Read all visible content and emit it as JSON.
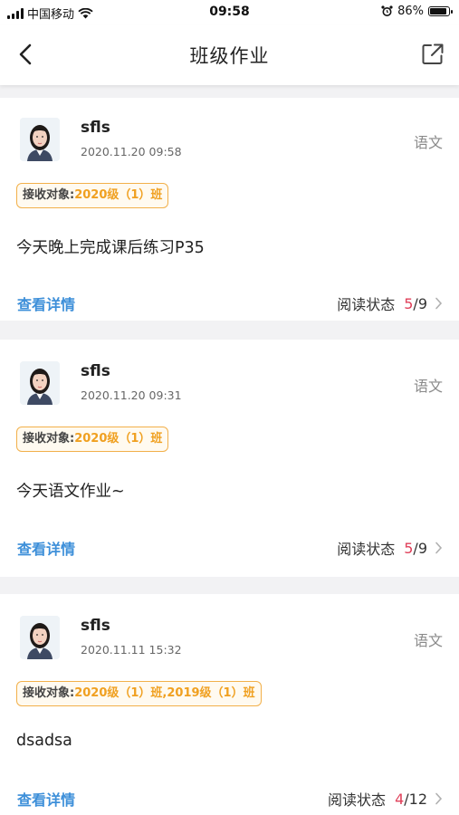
{
  "status_bar": {
    "carrier": "中国移动",
    "time": "09:58",
    "battery_percent": "86%",
    "battery_level": 0.86
  },
  "navbar": {
    "title": "班级作业",
    "back_icon": "chevron-left-icon",
    "share_icon": "share-external-icon"
  },
  "assignments": [
    {
      "user": "sfls",
      "datetime": "2020.11.20 09:58",
      "subject": "语文",
      "recipients_label": "接收对象:",
      "recipients": "2020级（1）班",
      "content": "今天晚上完成课后练习P35",
      "detail_label": "查看详情",
      "read_label": "阅读状态",
      "read_count": "5",
      "read_total": "/9"
    },
    {
      "user": "sfls",
      "datetime": "2020.11.20 09:31",
      "subject": "语文",
      "recipients_label": "接收对象:",
      "recipients": "2020级（1）班",
      "content": "今天语文作业~",
      "detail_label": "查看详情",
      "read_label": "阅读状态",
      "read_count": "5",
      "read_total": "/9"
    },
    {
      "user": "sfls",
      "datetime": "2020.11.11 15:32",
      "subject": "语文",
      "recipients_label": "接收对象:",
      "recipients": "2020级（1）班,2019级（1）班",
      "content": "dsadsa",
      "detail_label": "查看详情",
      "read_label": "阅读状态",
      "read_count": "4",
      "read_total": "/12"
    }
  ],
  "colors": {
    "accent_link": "#3d8fd9",
    "read_highlight": "#e0405a",
    "tag_border": "#f2b04a",
    "tag_text": "#f0a020"
  }
}
